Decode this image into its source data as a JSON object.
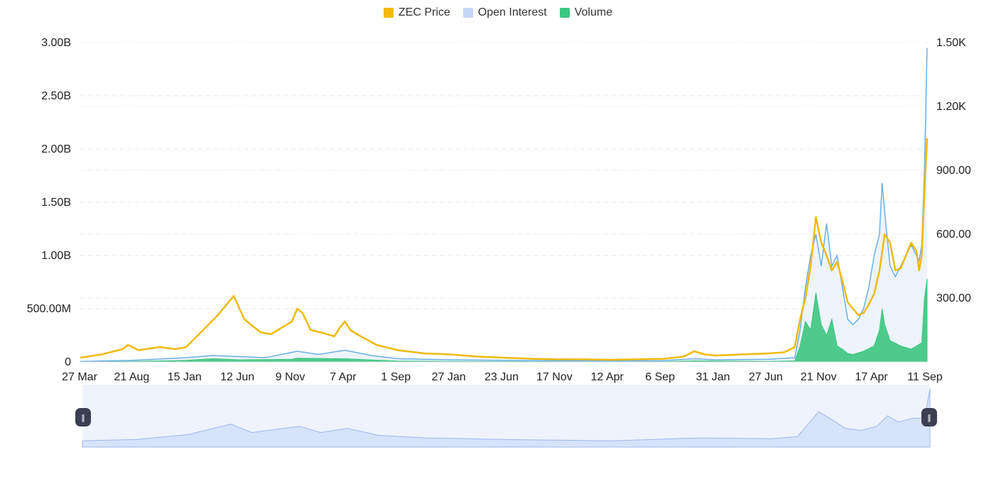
{
  "legend": [
    {
      "label": "ZEC Price",
      "color": "#f0b90b"
    },
    {
      "label": "Open Interest",
      "color": "#c4d6f7"
    },
    {
      "label": "Volume",
      "color": "#3cc77f"
    }
  ],
  "chart_data": {
    "type": "line",
    "x_tick_labels": [
      "27 Mar",
      "21 Aug",
      "15 Jan",
      "12 Jun",
      "9 Nov",
      "7 Apr",
      "1 Sep",
      "27 Jan",
      "23 Jun",
      "17 Nov",
      "12 Apr",
      "6 Sep",
      "31 Jan",
      "27 Jun",
      "21 Nov",
      "17 Apr",
      "11 Sep"
    ],
    "left_axis": {
      "tick_labels": [
        "0",
        "500.00M",
        "1.00B",
        "1.50B",
        "2.00B",
        "2.50B",
        "3.00B"
      ],
      "ylim": [
        0,
        3000000000
      ]
    },
    "right_axis": {
      "tick_labels": [
        "300.00",
        "600.00",
        "900.00",
        "1.20K",
        "1.50K"
      ],
      "ylim": [
        0,
        1500
      ]
    },
    "grid": true,
    "legend_position": "top-center",
    "x_index_range": [
      0,
      16
    ],
    "series": [
      {
        "name": "ZEC Price",
        "axis": "right",
        "color": "#f0b90b",
        "points": [
          [
            0,
            20
          ],
          [
            0.4,
            35
          ],
          [
            0.8,
            60
          ],
          [
            0.9,
            80
          ],
          [
            1.1,
            55
          ],
          [
            1.5,
            70
          ],
          [
            1.8,
            60
          ],
          [
            2.0,
            70
          ],
          [
            2.2,
            120
          ],
          [
            2.4,
            170
          ],
          [
            2.6,
            220
          ],
          [
            2.8,
            280
          ],
          [
            2.9,
            310
          ],
          [
            3.1,
            200
          ],
          [
            3.4,
            140
          ],
          [
            3.6,
            130
          ],
          [
            3.8,
            160
          ],
          [
            4.0,
            190
          ],
          [
            4.1,
            250
          ],
          [
            4.2,
            230
          ],
          [
            4.35,
            150
          ],
          [
            4.6,
            135
          ],
          [
            4.8,
            120
          ],
          [
            4.9,
            160
          ],
          [
            5.0,
            190
          ],
          [
            5.1,
            150
          ],
          [
            5.3,
            120
          ],
          [
            5.6,
            80
          ],
          [
            6.0,
            55
          ],
          [
            6.5,
            40
          ],
          [
            7.0,
            35
          ],
          [
            7.5,
            25
          ],
          [
            8.0,
            20
          ],
          [
            8.5,
            15
          ],
          [
            9.0,
            12
          ],
          [
            9.5,
            12
          ],
          [
            10.0,
            10
          ],
          [
            10.5,
            12
          ],
          [
            11.0,
            14
          ],
          [
            11.4,
            25
          ],
          [
            11.6,
            50
          ],
          [
            11.8,
            35
          ],
          [
            12.0,
            30
          ],
          [
            12.5,
            35
          ],
          [
            13.0,
            40
          ],
          [
            13.3,
            45
          ],
          [
            13.5,
            70
          ],
          [
            13.6,
            200
          ],
          [
            13.7,
            300
          ],
          [
            13.8,
            450
          ],
          [
            13.9,
            680
          ],
          [
            14.0,
            560
          ],
          [
            14.1,
            500
          ],
          [
            14.2,
            430
          ],
          [
            14.3,
            470
          ],
          [
            14.4,
            380
          ],
          [
            14.5,
            280
          ],
          [
            14.6,
            250
          ],
          [
            14.7,
            220
          ],
          [
            14.8,
            230
          ],
          [
            14.9,
            270
          ],
          [
            15.0,
            320
          ],
          [
            15.1,
            430
          ],
          [
            15.2,
            600
          ],
          [
            15.3,
            560
          ],
          [
            15.4,
            430
          ],
          [
            15.5,
            440
          ],
          [
            15.6,
            500
          ],
          [
            15.7,
            560
          ],
          [
            15.8,
            520
          ],
          [
            15.85,
            430
          ],
          [
            15.9,
            500
          ],
          [
            15.95,
            800
          ],
          [
            16.0,
            1050
          ]
        ]
      },
      {
        "name": "Open Interest",
        "axis": "left",
        "color": "#6ab0e8",
        "fill": "#eef4fc",
        "points": [
          [
            0,
            5000000
          ],
          [
            1.0,
            15000000
          ],
          [
            2.0,
            40000000
          ],
          [
            2.5,
            60000000
          ],
          [
            3.0,
            50000000
          ],
          [
            3.5,
            40000000
          ],
          [
            4.1,
            100000000
          ],
          [
            4.5,
            70000000
          ],
          [
            5.0,
            110000000
          ],
          [
            5.5,
            60000000
          ],
          [
            6.0,
            30000000
          ],
          [
            7.0,
            20000000
          ],
          [
            8.0,
            15000000
          ],
          [
            9.0,
            12000000
          ],
          [
            10.0,
            10000000
          ],
          [
            11.0,
            12000000
          ],
          [
            11.6,
            30000000
          ],
          [
            12.0,
            20000000
          ],
          [
            13.0,
            25000000
          ],
          [
            13.5,
            40000000
          ],
          [
            13.6,
            300000000
          ],
          [
            13.7,
            700000000
          ],
          [
            13.8,
            1000000000
          ],
          [
            13.9,
            1200000000
          ],
          [
            14.0,
            900000000
          ],
          [
            14.1,
            1300000000
          ],
          [
            14.2,
            900000000
          ],
          [
            14.3,
            1000000000
          ],
          [
            14.4,
            700000000
          ],
          [
            14.5,
            400000000
          ],
          [
            14.6,
            350000000
          ],
          [
            14.7,
            400000000
          ],
          [
            14.8,
            500000000
          ],
          [
            14.9,
            700000000
          ],
          [
            15.0,
            1000000000
          ],
          [
            15.1,
            1200000000
          ],
          [
            15.15,
            1680000000
          ],
          [
            15.2,
            1400000000
          ],
          [
            15.3,
            900000000
          ],
          [
            15.4,
            800000000
          ],
          [
            15.5,
            900000000
          ],
          [
            15.6,
            1000000000
          ],
          [
            15.7,
            1100000000
          ],
          [
            15.8,
            1000000000
          ],
          [
            15.85,
            950000000
          ],
          [
            15.9,
            1100000000
          ],
          [
            15.95,
            1800000000
          ],
          [
            16.0,
            2950000000
          ]
        ]
      },
      {
        "name": "Volume",
        "axis": "left",
        "color": "#3cc77f",
        "points": [
          [
            0,
            2000000
          ],
          [
            1.0,
            5000000
          ],
          [
            2.0,
            15000000
          ],
          [
            2.5,
            30000000
          ],
          [
            3.0,
            20000000
          ],
          [
            4.0,
            25000000
          ],
          [
            4.1,
            35000000
          ],
          [
            5.0,
            30000000
          ],
          [
            6.0,
            8000000
          ],
          [
            7.0,
            5000000
          ],
          [
            9.0,
            3000000
          ],
          [
            11.0,
            3000000
          ],
          [
            11.6,
            10000000
          ],
          [
            13.0,
            5000000
          ],
          [
            13.5,
            10000000
          ],
          [
            13.6,
            150000000
          ],
          [
            13.7,
            380000000
          ],
          [
            13.8,
            300000000
          ],
          [
            13.9,
            650000000
          ],
          [
            14.0,
            350000000
          ],
          [
            14.1,
            250000000
          ],
          [
            14.2,
            400000000
          ],
          [
            14.3,
            150000000
          ],
          [
            14.4,
            120000000
          ],
          [
            14.5,
            80000000
          ],
          [
            14.6,
            70000000
          ],
          [
            14.8,
            100000000
          ],
          [
            15.0,
            150000000
          ],
          [
            15.1,
            300000000
          ],
          [
            15.15,
            500000000
          ],
          [
            15.2,
            350000000
          ],
          [
            15.3,
            200000000
          ],
          [
            15.5,
            150000000
          ],
          [
            15.7,
            120000000
          ],
          [
            15.9,
            180000000
          ],
          [
            15.95,
            600000000
          ],
          [
            16.0,
            780000000
          ]
        ]
      }
    ],
    "navigator": {
      "series": [
        [
          0,
          15
        ],
        [
          1.0,
          18
        ],
        [
          2.0,
          30
        ],
        [
          2.8,
          55
        ],
        [
          3.2,
          35
        ],
        [
          4.1,
          50
        ],
        [
          4.5,
          35
        ],
        [
          5.0,
          45
        ],
        [
          5.6,
          28
        ],
        [
          6.5,
          22
        ],
        [
          8.0,
          18
        ],
        [
          10.0,
          15
        ],
        [
          11.6,
          22
        ],
        [
          13.0,
          20
        ],
        [
          13.5,
          25
        ],
        [
          13.8,
          70
        ],
        [
          13.9,
          85
        ],
        [
          14.1,
          70
        ],
        [
          14.4,
          45
        ],
        [
          14.7,
          40
        ],
        [
          15.0,
          50
        ],
        [
          15.2,
          75
        ],
        [
          15.4,
          60
        ],
        [
          15.7,
          70
        ],
        [
          15.9,
          68
        ],
        [
          16.0,
          140
        ]
      ],
      "ylim": [
        0,
        150
      ]
    }
  }
}
